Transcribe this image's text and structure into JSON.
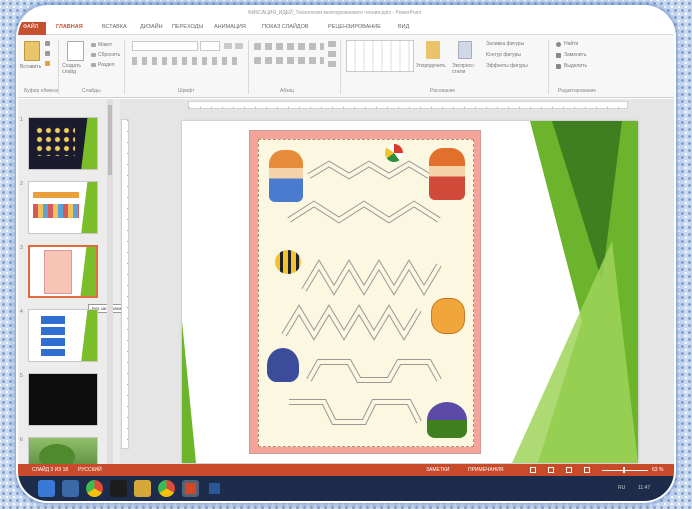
{
  "window": {
    "title": "ФИКСАЦИЯ_ИДЕЙ_Технологии многоуровневого чтения.pptx - PowerPoint"
  },
  "ribbon": {
    "tabs": [
      "ФАЙЛ",
      "ГЛАВНАЯ",
      "ВСТАВКА",
      "ДИЗАЙН",
      "ПЕРЕХОДЫ",
      "АНИМАЦИЯ",
      "ПОКАЗ СЛАЙДОВ",
      "РЕЦЕНЗИРОВАНИЕ",
      "ВИД"
    ],
    "active_tab": "ГЛАВНАЯ",
    "clipboard": {
      "paste": "Вставить",
      "cut": "Вырезать",
      "copy": "Копировать",
      "format": "Формат по образцу",
      "label": "Буфер обмена"
    },
    "slides": {
      "new_slide": "Создать слайд",
      "layout": "Макет",
      "reset": "Сбросить",
      "section": "Раздел",
      "label": "Слайды"
    },
    "font": {
      "label": "Шрифт"
    },
    "paragraph": {
      "label": "Абзац"
    },
    "drawing": {
      "arrange": "Упорядочить",
      "styles": "Экспресс-стили",
      "fill": "Заливка фигуры",
      "outline": "Контур фигуры",
      "effects": "Эффекты фигуры",
      "label": "Рисование"
    },
    "editing": {
      "find": "Найти",
      "replace": "Заменить",
      "select": "Выделить",
      "label": "Редактирование"
    }
  },
  "thumbnails": [
    {
      "num": "1",
      "colors": [
        "#1b1b2f",
        "#7abf2a"
      ]
    },
    {
      "num": "2",
      "colors": [
        "#ffffff",
        "#7abf2a"
      ]
    },
    {
      "num": "3",
      "colors": [
        "#f7c4b5",
        "#7abf2a"
      ],
      "selected": true
    },
    {
      "num": "4",
      "colors": [
        "#ffffff",
        "#7abf2a"
      ]
    },
    {
      "num": "5",
      "colors": [
        "#0c0c0c",
        "#0c0c0c"
      ]
    },
    {
      "num": "6",
      "colors": [
        "#5c8f3a",
        "#3e6b25"
      ]
    }
  ],
  "tooltip": "Без заголовка",
  "statusbar": {
    "slide_info": "СЛАЙД 3 ИЗ 18",
    "language": "РУССКИЙ",
    "notes": "ЗАМЕТКИ",
    "comments": "ПРИМЕЧАНИЯ",
    "zoom": "63 %"
  },
  "taskbar": {
    "time": "11:47",
    "lang": "RU"
  },
  "colors": {
    "accent": "#c74b2b",
    "green": "#6bb42c",
    "dark_green": "#3f7f20",
    "pink": "#f4a49b"
  }
}
